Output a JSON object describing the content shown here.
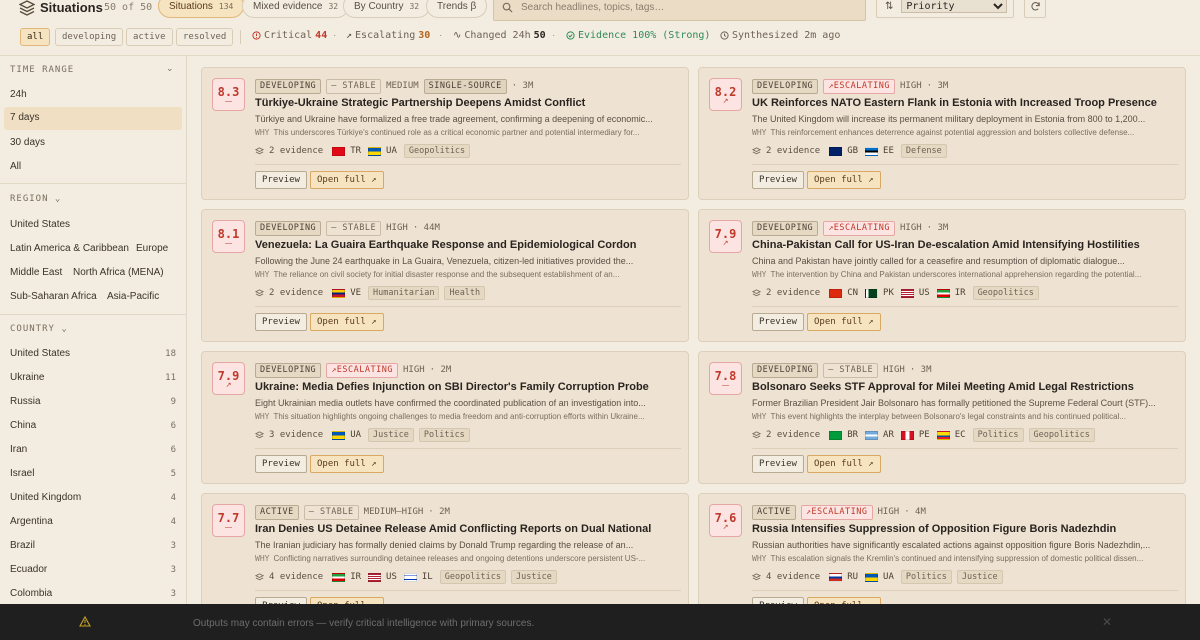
{
  "app": {
    "title": "Situations",
    "count": "50 of 50"
  },
  "tabs": [
    {
      "label": "Situations",
      "count": "134"
    },
    {
      "label": "Mixed evidence",
      "count": "32"
    },
    {
      "label": "By Country",
      "count": "32"
    },
    {
      "label": "Trends β",
      "count": ""
    }
  ],
  "search": {
    "placeholder": "Search headlines, topics, tags…"
  },
  "sort": {
    "value": "Priority"
  },
  "filters": [
    "all",
    "developing",
    "active",
    "resolved"
  ],
  "stats": {
    "critical_label": "Critical",
    "critical_value": "44",
    "escalating_label": "Escalating",
    "escalating_value": "30",
    "changed_label": "Changed 24h",
    "changed_value": "50",
    "evidence_label": "Evidence 100% (Strong)",
    "synth_label": "Synthesized 2m ago"
  },
  "sidebar": {
    "time_title": "TIME RANGE",
    "time_items": [
      "24h",
      "7 days",
      "30 days",
      "All"
    ],
    "region_title": "REGION",
    "regions": [
      "United States",
      "Latin America & Caribbean",
      "Europe",
      "Middle East",
      "North Africa (MENA)",
      "Sub-Saharan Africa",
      "Asia-Pacific"
    ],
    "country_title": "COUNTRY",
    "countries": [
      {
        "name": "United States",
        "count": "18"
      },
      {
        "name": "Ukraine",
        "count": "11"
      },
      {
        "name": "Russia",
        "count": "9"
      },
      {
        "name": "China",
        "count": "6"
      },
      {
        "name": "Iran",
        "count": "6"
      },
      {
        "name": "Israel",
        "count": "5"
      },
      {
        "name": "United Kingdom",
        "count": "4"
      },
      {
        "name": "Argentina",
        "count": "4"
      },
      {
        "name": "Brazil",
        "count": "3"
      },
      {
        "name": "Ecuador",
        "count": "3"
      },
      {
        "name": "Colombia",
        "count": "3"
      }
    ]
  },
  "buttons": {
    "preview": "Preview",
    "open": "Open full ↗"
  },
  "why_label": "WHY",
  "cards": [
    {
      "score": "8.3",
      "trend_icon": "—",
      "status": "DEVELOPING",
      "trend": "— STABLE",
      "trend_type": "stable",
      "meta": "MEDIUM",
      "single": "SINGLE-SOURCE",
      "age": "· 3M",
      "headline": "Türkiye-Ukraine Strategic Partnership Deepens Amidst Conflict",
      "summary": "Türkiye and Ukraine have formalized a free trade agreement, confirming a deepening of economic...",
      "why": "This underscores Türkiye's continued role as a critical economic partner and potential intermediary for...",
      "evidence": "2 evidence",
      "countries": [
        {
          "code": "TR",
          "flag": "tr"
        },
        {
          "code": "UA",
          "flag": "ua"
        }
      ],
      "tags": [
        "Geopolitics"
      ]
    },
    {
      "score": "8.2",
      "trend_icon": "↗",
      "status": "DEVELOPING",
      "trend": "↗ESCALATING",
      "trend_type": "esc",
      "meta": "HIGH",
      "single": "",
      "age": "· 3M",
      "headline": "UK Reinforces NATO Eastern Flank in Estonia with Increased Troop Presence",
      "summary": "The United Kingdom will increase its permanent military deployment in Estonia from 800 to 1,200...",
      "why": "This reinforcement enhances deterrence against potential aggression and bolsters collective defense...",
      "evidence": "2 evidence",
      "countries": [
        {
          "code": "GB",
          "flag": "gb"
        },
        {
          "code": "EE",
          "flag": "ee"
        }
      ],
      "tags": [
        "Defense"
      ]
    },
    {
      "score": "8.1",
      "trend_icon": "—",
      "status": "DEVELOPING",
      "trend": "— STABLE",
      "trend_type": "stable",
      "meta": "HIGH",
      "single": "",
      "age": "· 44M",
      "headline": "Venezuela: La Guaira Earthquake Response and Epidemiological Cordon",
      "summary": "Following the June 24 earthquake in La Guaira, Venezuela, citizen-led initiatives provided the...",
      "why": "The reliance on civil society for initial disaster response and the subsequent establishment of an...",
      "evidence": "2 evidence",
      "countries": [
        {
          "code": "VE",
          "flag": "ve"
        }
      ],
      "tags": [
        "Humanitarian",
        "Health"
      ]
    },
    {
      "score": "7.9",
      "trend_icon": "↗",
      "status": "DEVELOPING",
      "trend": "↗ESCALATING",
      "trend_type": "esc",
      "meta": "HIGH",
      "single": "",
      "age": "· 3M",
      "headline": "China-Pakistan Call for US-Iran De-escalation Amid Intensifying Hostilities",
      "summary": "China and Pakistan have jointly called for a ceasefire and resumption of diplomatic dialogue...",
      "why": "The intervention by China and Pakistan underscores international apprehension regarding the potential...",
      "evidence": "2 evidence",
      "countries": [
        {
          "code": "CN",
          "flag": "cn"
        },
        {
          "code": "PK",
          "flag": "pk"
        },
        {
          "code": "US",
          "flag": "us"
        },
        {
          "code": "IR",
          "flag": "ir"
        }
      ],
      "tags": [
        "Geopolitics"
      ]
    },
    {
      "score": "7.9",
      "trend_icon": "↗",
      "status": "DEVELOPING",
      "trend": "↗ESCALATING",
      "trend_type": "esc",
      "meta": "HIGH",
      "single": "",
      "age": "· 2M",
      "headline": "Ukraine: Media Defies Injunction on SBI Director's Family Corruption Probe",
      "summary": "Eight Ukrainian media outlets have confirmed the coordinated publication of an investigation into...",
      "why": "This situation highlights ongoing challenges to media freedom and anti-corruption efforts within Ukraine...",
      "evidence": "3 evidence",
      "countries": [
        {
          "code": "UA",
          "flag": "ua"
        }
      ],
      "tags": [
        "Justice",
        "Politics"
      ]
    },
    {
      "score": "7.8",
      "trend_icon": "—",
      "status": "DEVELOPING",
      "trend": "— STABLE",
      "trend_type": "stable",
      "meta": "HIGH",
      "single": "",
      "age": "· 3M",
      "headline": "Bolsonaro Seeks STF Approval for Milei Meeting Amid Legal Restrictions",
      "summary": "Former Brazilian President Jair Bolsonaro has formally petitioned the Supreme Federal Court (STF)...",
      "why": "This event highlights the interplay between Bolsonaro's legal constraints and his continued political...",
      "evidence": "2 evidence",
      "countries": [
        {
          "code": "BR",
          "flag": "br"
        },
        {
          "code": "AR",
          "flag": "ar"
        },
        {
          "code": "PE",
          "flag": "pe"
        },
        {
          "code": "EC",
          "flag": "ec"
        }
      ],
      "tags": [
        "Politics",
        "Geopolitics"
      ]
    },
    {
      "score": "7.7",
      "trend_icon": "—",
      "status": "ACTIVE",
      "trend": "— STABLE",
      "trend_type": "stable",
      "meta": "MEDIUM–HIGH",
      "single": "",
      "age": "· 2M",
      "headline": "Iran Denies US Detainee Release Amid Conflicting Reports on Dual National",
      "summary": "The Iranian judiciary has formally denied claims by Donald Trump regarding the release of an...",
      "why": "Conflicting narratives surrounding detainee releases and ongoing detentions underscore persistent US-...",
      "evidence": "4 evidence",
      "countries": [
        {
          "code": "IR",
          "flag": "ir"
        },
        {
          "code": "US",
          "flag": "us"
        },
        {
          "code": "IL",
          "flag": "il"
        }
      ],
      "tags": [
        "Geopolitics",
        "Justice"
      ]
    },
    {
      "score": "7.6",
      "trend_icon": "↗",
      "status": "ACTIVE",
      "trend": "↗ESCALATING",
      "trend_type": "esc",
      "meta": "HIGH",
      "single": "",
      "age": "· 4M",
      "headline": "Russia Intensifies Suppression of Opposition Figure Boris Nadezhdin",
      "summary": "Russian authorities have significantly escalated actions against opposition figure Boris Nadezhdin,...",
      "why": "This escalation signals the Kremlin's continued and intensifying suppression of domestic political dissen...",
      "evidence": "4 evidence",
      "countries": [
        {
          "code": "RU",
          "flag": "ru"
        },
        {
          "code": "UA",
          "flag": "ua"
        }
      ],
      "tags": [
        "Politics",
        "Justice"
      ]
    }
  ],
  "footer": {
    "text": "Outputs may contain errors — verify critical intelligence with primary sources.",
    "close": "✕"
  },
  "colors": {
    "accent": "#e2b77a",
    "critical": "#c0392b",
    "evidence": "#2e8b57",
    "background": "#f3ede1"
  }
}
